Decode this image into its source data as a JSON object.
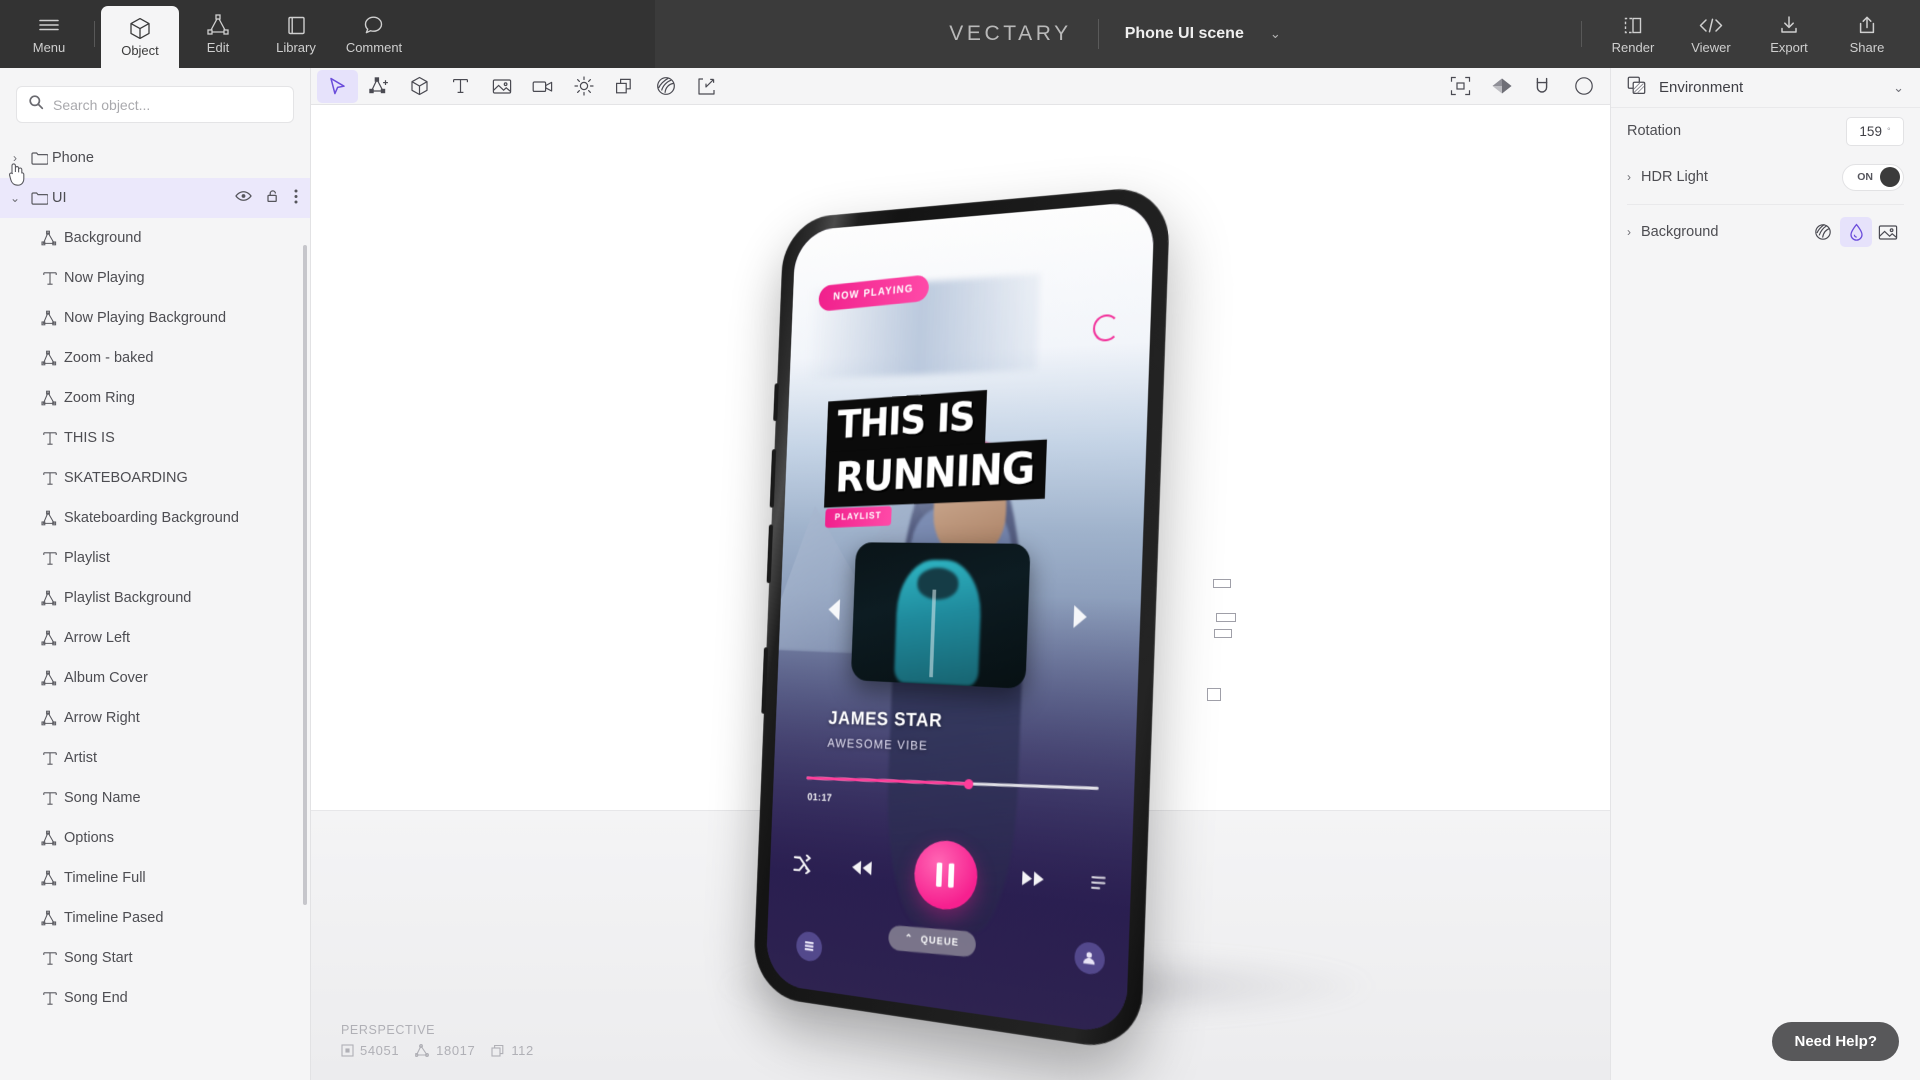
{
  "header": {
    "left_buttons": [
      {
        "label": "Menu",
        "icon": "hamburger-icon",
        "active": false
      },
      {
        "label": "Object",
        "icon": "cube-icon",
        "active": true
      },
      {
        "label": "Edit",
        "icon": "edit-mesh-icon",
        "active": false
      },
      {
        "label": "Library",
        "icon": "library-book-icon",
        "active": false
      },
      {
        "label": "Comment",
        "icon": "comment-bubble-icon",
        "active": false
      }
    ],
    "brand": "VECTARY",
    "scene_name": "Phone UI scene",
    "scene_chevron": "⌄",
    "right_buttons": [
      {
        "label": "Render",
        "icon": "render-panel-icon"
      },
      {
        "label": "Viewer",
        "icon": "code-viewer-icon"
      },
      {
        "label": "Export",
        "icon": "download-icon"
      },
      {
        "label": "Share",
        "icon": "share-upload-icon"
      }
    ]
  },
  "toolbar": {
    "left_tools": [
      {
        "name": "select-cursor-tool",
        "active": true
      },
      {
        "name": "add-vertex-tool",
        "active": false
      },
      {
        "name": "add-object-cube-tool",
        "active": false
      },
      {
        "name": "add-text-tool",
        "active": false
      },
      {
        "name": "add-image-tool",
        "active": false
      },
      {
        "name": "add-camera-tool",
        "active": false
      },
      {
        "name": "add-light-tool",
        "active": false
      },
      {
        "name": "duplicate-tool",
        "active": false
      },
      {
        "name": "material-tool",
        "active": false
      },
      {
        "name": "import-tool",
        "active": false
      }
    ],
    "right_tools": [
      {
        "name": "focus-frame-tool"
      },
      {
        "name": "shading-tool"
      },
      {
        "name": "magnet-snap-tool"
      },
      {
        "name": "orbit-tool"
      }
    ]
  },
  "sidebar": {
    "search": {
      "value": "",
      "placeholder": "Search object...",
      "icon": "search-icon"
    },
    "tree": [
      {
        "label": "Phone",
        "type": "folder",
        "caret": "›",
        "depth": 0,
        "selected": false
      },
      {
        "label": "UI",
        "type": "folder",
        "caret": "⌄",
        "depth": 0,
        "selected": true,
        "actions": [
          "eye-visibility-icon",
          "lock-icon",
          "kebab-menu-icon"
        ]
      },
      {
        "label": "Background",
        "type": "mesh",
        "depth": 1,
        "selected": false
      },
      {
        "label": "Now Playing",
        "type": "text",
        "depth": 1,
        "selected": false
      },
      {
        "label": "Now Playing Background",
        "type": "mesh",
        "depth": 1,
        "selected": false
      },
      {
        "label": "Zoom - baked",
        "type": "mesh",
        "depth": 1,
        "selected": false
      },
      {
        "label": "Zoom Ring",
        "type": "mesh",
        "depth": 1,
        "selected": false
      },
      {
        "label": "THIS IS",
        "type": "text",
        "depth": 1,
        "selected": false
      },
      {
        "label": "SKATEBOARDING",
        "type": "text",
        "depth": 1,
        "selected": false
      },
      {
        "label": "Skateboarding Background",
        "type": "mesh",
        "depth": 1,
        "selected": false
      },
      {
        "label": "Playlist",
        "type": "text",
        "depth": 1,
        "selected": false
      },
      {
        "label": "Playlist Background",
        "type": "mesh",
        "depth": 1,
        "selected": false
      },
      {
        "label": "Arrow Left",
        "type": "mesh",
        "depth": 1,
        "selected": false
      },
      {
        "label": "Album Cover",
        "type": "mesh",
        "depth": 1,
        "selected": false
      },
      {
        "label": "Arrow Right",
        "type": "mesh",
        "depth": 1,
        "selected": false
      },
      {
        "label": "Artist",
        "type": "text",
        "depth": 1,
        "selected": false
      },
      {
        "label": "Song Name",
        "type": "text",
        "depth": 1,
        "selected": false
      },
      {
        "label": "Options",
        "type": "mesh",
        "depth": 1,
        "selected": false
      },
      {
        "label": "Timeline Full",
        "type": "mesh",
        "depth": 1,
        "selected": false
      },
      {
        "label": "Timeline Pased",
        "type": "mesh",
        "depth": 1,
        "selected": false
      },
      {
        "label": "Song Start",
        "type": "text",
        "depth": 1,
        "selected": false
      },
      {
        "label": "Song End",
        "type": "text",
        "depth": 1,
        "selected": false
      }
    ]
  },
  "environment": {
    "title": "Environment",
    "icon": "environment-icon",
    "collapse_chevron": "⌄",
    "rotation": {
      "label": "Rotation",
      "value": "159",
      "unit": "°"
    },
    "hdr_light": {
      "label": "HDR Light",
      "caret": "›",
      "toggle_state": "ON"
    },
    "background": {
      "label": "Background",
      "caret": "›",
      "options": [
        {
          "name": "hdr-sphere-icon",
          "active": false
        },
        {
          "name": "color-droplet-icon",
          "active": true
        },
        {
          "name": "image-icon",
          "active": false
        }
      ]
    }
  },
  "viewport": {
    "camera_mode": "PERSPECTIVE",
    "stats": [
      {
        "icon": "vertices-icon",
        "value": "54051"
      },
      {
        "icon": "triangles-icon",
        "value": "18017"
      },
      {
        "icon": "objects-icon",
        "value": "112"
      }
    ],
    "phone_ui": {
      "now_playing_badge": "NOW PLAYING",
      "headline_line1": "THIS IS",
      "headline_line2": "RUNNING",
      "playlist_badge": "PLAYLIST",
      "song_name": "JAMES STAR",
      "artist": "AWESOME VIBE",
      "song_start": "01:17",
      "queue_label": "QUEUE",
      "queue_caret": "⌃",
      "progress_percent": 57
    }
  },
  "help": {
    "label": "Need Help?"
  },
  "colors": {
    "accent_purple": "#6b4ddb",
    "accent_purple_bg": "#e6e2fb",
    "header_dark": "#3b3b3b",
    "header_dark_left": "#333333",
    "panel_bg": "#f5f5f6",
    "pink": "#f6208f"
  }
}
